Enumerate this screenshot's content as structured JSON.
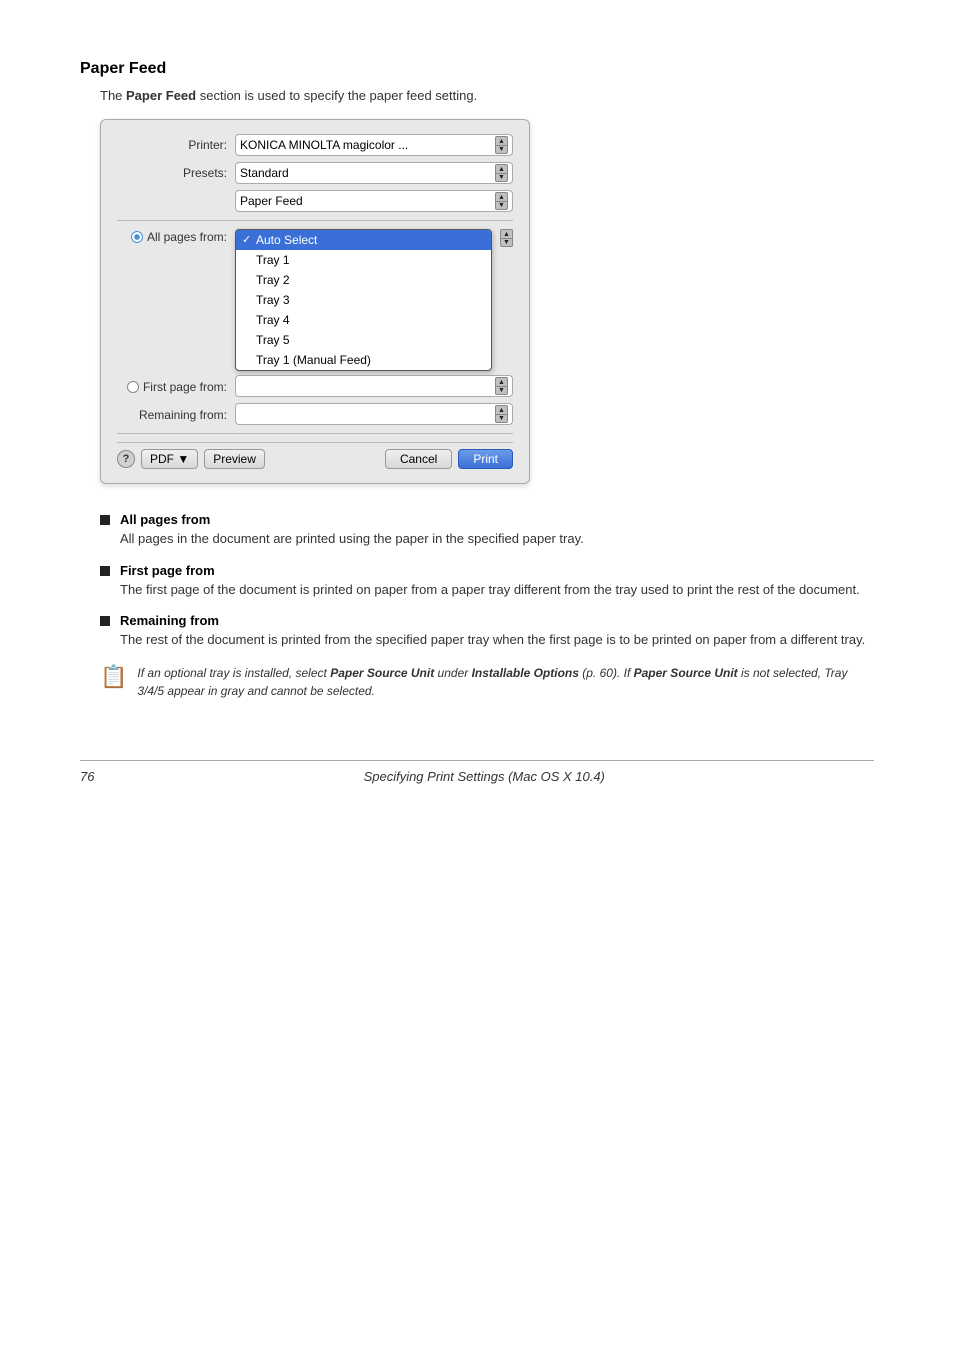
{
  "page": {
    "title": "Paper Feed",
    "intro": "The Paper Feed section is used to specify the paper feed setting."
  },
  "dialog": {
    "printer_label": "Printer:",
    "printer_value": "KONICA MINOLTA magicolor ...",
    "presets_label": "Presets:",
    "presets_value": "Standard",
    "tab_label": "Paper Feed",
    "all_pages_label": "All pages from:",
    "first_page_label": "First page from:",
    "remaining_label": "Remaining from:",
    "dropdown_items": [
      {
        "label": "Auto Select",
        "selected": true
      },
      {
        "label": "Tray 1",
        "selected": false
      },
      {
        "label": "Tray 2",
        "selected": false
      },
      {
        "label": "Tray 3",
        "selected": false
      },
      {
        "label": "Tray 4",
        "selected": false
      },
      {
        "label": "Tray 5",
        "selected": false
      },
      {
        "label": "Tray 1 (Manual Feed)",
        "selected": false
      }
    ],
    "pdf_label": "PDF ▼",
    "preview_label": "Preview",
    "cancel_label": "Cancel",
    "print_label": "Print",
    "help_label": "?"
  },
  "bullets": [
    {
      "title": "All pages from",
      "desc": "All pages in the document are printed using the paper in the specified paper tray."
    },
    {
      "title": "First page from",
      "desc": "The first page of the document is printed on paper from a paper tray different from the tray used to print the rest of the document."
    },
    {
      "title": "Remaining from",
      "desc": "The rest of the document is printed from the specified paper tray when the first page is to be printed on paper from a different tray."
    }
  ],
  "note": {
    "text": "If an optional tray is installed, select Paper Source Unit under Installable Options (p. 60). If Paper Source Unit is not selected, Tray 3/4/5 appear in gray and cannot be selected."
  },
  "footer": {
    "page_num": "76",
    "title": "Specifying Print Settings (Mac OS X 10.4)"
  }
}
